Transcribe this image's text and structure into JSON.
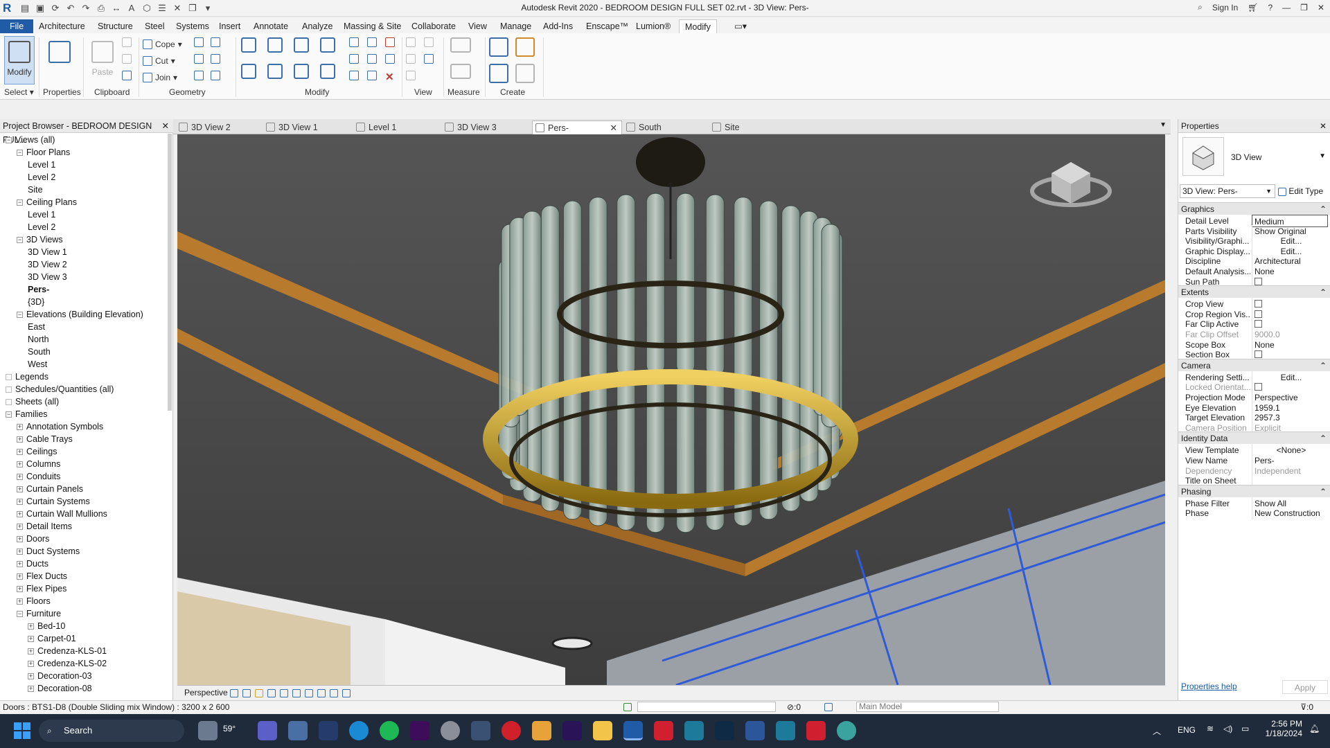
{
  "titlebar": {
    "title": "Autodesk Revit 2020 - BEDROOM DESIGN FULL SET 02.rvt - 3D View: Pers-",
    "sign_in": "Sign In",
    "logo": "R"
  },
  "ribbon_tabs": [
    "File",
    "Architecture",
    "Structure",
    "Steel",
    "Systems",
    "Insert",
    "Annotate",
    "Analyze",
    "Massing & Site",
    "Collaborate",
    "View",
    "Manage",
    "Add-Ins",
    "Enscape™",
    "Lumion®",
    "Modify"
  ],
  "ribbon": {
    "modify_label": "Modify",
    "properties_label": "Properties",
    "paste_label": "Paste",
    "cope_label": "Cope",
    "cut_label": "Cut",
    "join_label": "Join",
    "panels": {
      "select": "Select",
      "properties": "Properties",
      "clipboard": "Clipboard",
      "geometry": "Geometry",
      "modify": "Modify",
      "view": "View",
      "measure": "Measure",
      "create": "Create"
    }
  },
  "browser": {
    "title": "Project Browser - BEDROOM DESIGN FUL...",
    "items": [
      {
        "label": "Views (all)",
        "level": 0,
        "exp": "-"
      },
      {
        "label": "Floor Plans",
        "level": 1,
        "exp": "-"
      },
      {
        "label": "Level 1",
        "level": 2
      },
      {
        "label": "Level 2",
        "level": 2
      },
      {
        "label": "Site",
        "level": 2
      },
      {
        "label": "Ceiling Plans",
        "level": 1,
        "exp": "-"
      },
      {
        "label": "Level 1",
        "level": 2
      },
      {
        "label": "Level 2",
        "level": 2
      },
      {
        "label": "3D Views",
        "level": 1,
        "exp": "-"
      },
      {
        "label": "3D View 1",
        "level": 2
      },
      {
        "label": "3D View 2",
        "level": 2
      },
      {
        "label": "3D View 3",
        "level": 2
      },
      {
        "label": "Pers-",
        "level": 2,
        "bold": true
      },
      {
        "label": "{3D}",
        "level": 2
      },
      {
        "label": "Elevations (Building Elevation)",
        "level": 1,
        "exp": "-"
      },
      {
        "label": "East",
        "level": 2
      },
      {
        "label": "North",
        "level": 2
      },
      {
        "label": "South",
        "level": 2
      },
      {
        "label": "West",
        "level": 2
      },
      {
        "label": "Legends",
        "level": 0
      },
      {
        "label": "Schedules/Quantities (all)",
        "level": 0
      },
      {
        "label": "Sheets (all)",
        "level": 0
      },
      {
        "label": "Families",
        "level": 0,
        "exp": "-"
      },
      {
        "label": "Annotation Symbols",
        "level": 1,
        "exp": "+"
      },
      {
        "label": "Cable Trays",
        "level": 1,
        "exp": "+"
      },
      {
        "label": "Ceilings",
        "level": 1,
        "exp": "+"
      },
      {
        "label": "Columns",
        "level": 1,
        "exp": "+"
      },
      {
        "label": "Conduits",
        "level": 1,
        "exp": "+"
      },
      {
        "label": "Curtain Panels",
        "level": 1,
        "exp": "+"
      },
      {
        "label": "Curtain Systems",
        "level": 1,
        "exp": "+"
      },
      {
        "label": "Curtain Wall Mullions",
        "level": 1,
        "exp": "+"
      },
      {
        "label": "Detail Items",
        "level": 1,
        "exp": "+"
      },
      {
        "label": "Doors",
        "level": 1,
        "exp": "+"
      },
      {
        "label": "Duct Systems",
        "level": 1,
        "exp": "+"
      },
      {
        "label": "Ducts",
        "level": 1,
        "exp": "+"
      },
      {
        "label": "Flex Ducts",
        "level": 1,
        "exp": "+"
      },
      {
        "label": "Flex Pipes",
        "level": 1,
        "exp": "+"
      },
      {
        "label": "Floors",
        "level": 1,
        "exp": "+"
      },
      {
        "label": "Furniture",
        "level": 1,
        "exp": "-"
      },
      {
        "label": "Bed-10",
        "level": 2,
        "exp": "+"
      },
      {
        "label": "Carpet-01",
        "level": 2,
        "exp": "+"
      },
      {
        "label": "Credenza-KLS-01",
        "level": 2,
        "exp": "+"
      },
      {
        "label": "Credenza-KLS-02",
        "level": 2,
        "exp": "+"
      },
      {
        "label": "Decoration-03",
        "level": 2,
        "exp": "+"
      },
      {
        "label": "Decoration-08",
        "level": 2,
        "exp": "+"
      }
    ]
  },
  "view_tabs": [
    {
      "label": "3D View 2",
      "active": false
    },
    {
      "label": "3D View 1",
      "active": false
    },
    {
      "label": "Level 1",
      "active": false
    },
    {
      "label": "3D View 3",
      "active": false
    },
    {
      "label": "Pers-",
      "active": true
    },
    {
      "label": "South",
      "active": false
    },
    {
      "label": "Site",
      "active": false
    }
  ],
  "view_bar": {
    "projection": "Perspective"
  },
  "properties": {
    "title": "Properties",
    "type_name": "3D View",
    "selector": "3D View: Pers-",
    "edit_type": "Edit Type",
    "help": "Properties help",
    "apply": "Apply",
    "groups": [
      {
        "name": "Graphics",
        "rows": [
          {
            "k": "Detail Level",
            "v": "Medium"
          },
          {
            "k": "Parts Visibility",
            "v": "Show Original"
          },
          {
            "k": "Visibility/Graphi...",
            "v": "Edit...",
            "btn": true
          },
          {
            "k": "Graphic Display...",
            "v": "Edit...",
            "btn": true
          },
          {
            "k": "Discipline",
            "v": "Architectural"
          },
          {
            "k": "Default Analysis...",
            "v": "None"
          },
          {
            "k": "Sun Path",
            "v": "",
            "cb": true
          }
        ]
      },
      {
        "name": "Extents",
        "rows": [
          {
            "k": "Crop View",
            "v": "",
            "cb": true
          },
          {
            "k": "Crop Region Vis...",
            "v": "",
            "cb": true
          },
          {
            "k": "Far Clip Active",
            "v": "",
            "cb": true
          },
          {
            "k": "Far Clip Offset",
            "v": "9000.0",
            "dis": true
          },
          {
            "k": "Scope Box",
            "v": "None"
          },
          {
            "k": "Section Box",
            "v": "",
            "cb": true
          }
        ]
      },
      {
        "name": "Camera",
        "rows": [
          {
            "k": "Rendering Setti...",
            "v": "Edit...",
            "btn": true
          },
          {
            "k": "Locked Orientat...",
            "v": "",
            "cb": true,
            "dis": true
          },
          {
            "k": "Projection Mode",
            "v": "Perspective"
          },
          {
            "k": "Eye Elevation",
            "v": "1959.1"
          },
          {
            "k": "Target Elevation",
            "v": "2957.3"
          },
          {
            "k": "Camera Position",
            "v": "Explicit",
            "dis": true
          }
        ]
      },
      {
        "name": "Identity Data",
        "rows": [
          {
            "k": "View Template",
            "v": "<None>",
            "btn": true
          },
          {
            "k": "View Name",
            "v": "Pers-"
          },
          {
            "k": "Dependency",
            "v": "Independent",
            "dis": true
          },
          {
            "k": "Title on Sheet",
            "v": ""
          }
        ]
      },
      {
        "name": "Phasing",
        "rows": [
          {
            "k": "Phase Filter",
            "v": "Show All"
          },
          {
            "k": "Phase",
            "v": "New Construction"
          }
        ]
      }
    ]
  },
  "status": {
    "text": "Doors : BTS1-D8 (Double Sliding mix Window) : 3200 x 2 600",
    "count": ":0",
    "model": "Main Model",
    "filter_count": ":0"
  },
  "taskbar": {
    "search": "Search",
    "weather": "59°",
    "lang": "ENG",
    "time": "2:56 PM",
    "date": "1/18/2024"
  }
}
